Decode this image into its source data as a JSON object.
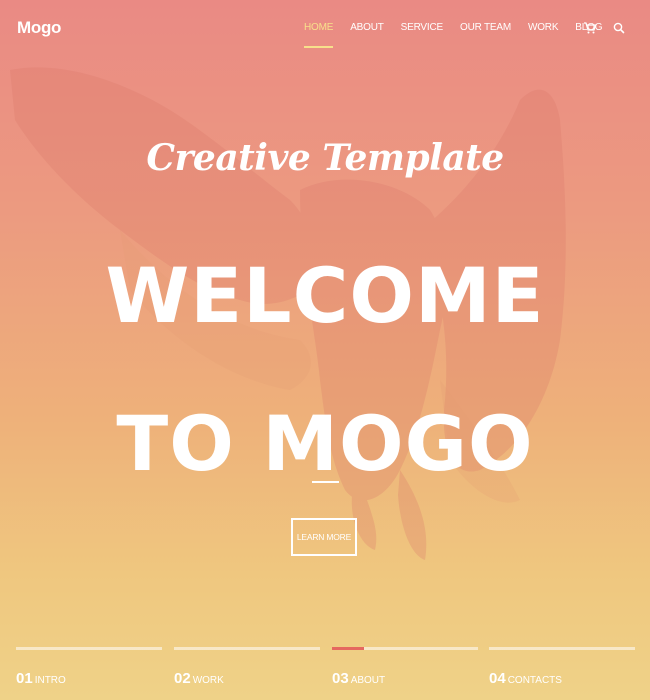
{
  "header": {
    "logo": "Mogo",
    "nav": [
      {
        "label": "HOME",
        "active": true
      },
      {
        "label": "ABOUT",
        "active": false
      },
      {
        "label": "SERVICE",
        "active": false
      },
      {
        "label": "OUR TEAM",
        "active": false
      },
      {
        "label": "WORK",
        "active": false
      },
      {
        "label": "BLOG",
        "active": false
      }
    ],
    "icons": [
      "cart-icon",
      "search-icon"
    ]
  },
  "hero": {
    "subtitle": "Creative Template",
    "title_line1": "WELCOME",
    "title_line2": "TO MOGO",
    "cta_label": "LEARN MORE"
  },
  "sections": [
    {
      "number": "01",
      "label": "INTRO",
      "active": false
    },
    {
      "number": "02",
      "label": "WORK",
      "active": false
    },
    {
      "number": "03",
      "label": "ABOUT",
      "active": true
    },
    {
      "number": "04",
      "label": "CONTACTS",
      "active": false
    }
  ],
  "colors": {
    "gradient_top": "#ea8a84",
    "gradient_bottom": "#efd288",
    "accent_yellow": "#f7e08b",
    "accent_red": "#e5685f",
    "text": "#ffffff"
  }
}
